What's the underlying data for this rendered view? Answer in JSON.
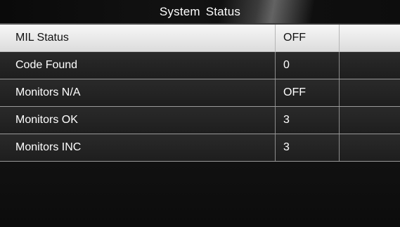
{
  "header": {
    "title": "System  Status"
  },
  "rows": [
    {
      "label": "MIL Status",
      "value": "OFF",
      "selected": true
    },
    {
      "label": "Code Found",
      "value": "0",
      "selected": false
    },
    {
      "label": "Monitors N/A",
      "value": "OFF",
      "selected": false
    },
    {
      "label": "Monitors OK",
      "value": "3",
      "selected": false
    },
    {
      "label": "Monitors INC",
      "value": "3",
      "selected": false
    }
  ],
  "colors": {
    "selected_row_background": "#e8e8e8",
    "row_background": "#222222",
    "row_text": "#ffffff",
    "selected_row_text": "#111111"
  }
}
